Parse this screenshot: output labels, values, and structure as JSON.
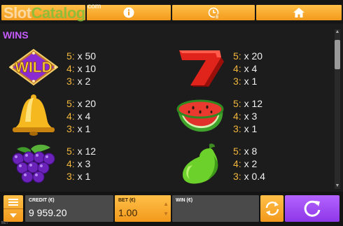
{
  "watermark": {
    "brand_part1": "Slot",
    "brand_part2": "Catalog",
    "domain": "com"
  },
  "topbar": {
    "tabs": [
      {
        "icon": "info-icon"
      },
      {
        "icon": "history-icon"
      },
      {
        "icon": "home-icon"
      }
    ],
    "accent": "#f5a623"
  },
  "paytable": {
    "title": "WINS",
    "symbols": [
      {
        "name": "wild",
        "icon": "wild-icon",
        "label": "WILD",
        "pays": [
          {
            "n": "5:",
            "v": "x 50"
          },
          {
            "n": "4:",
            "v": "x 10"
          },
          {
            "n": "3:",
            "v": "x 2"
          }
        ]
      },
      {
        "name": "seven",
        "icon": "seven-icon",
        "pays": [
          {
            "n": "5:",
            "v": "x 20"
          },
          {
            "n": "4:",
            "v": "x 4"
          },
          {
            "n": "3:",
            "v": "x 1"
          }
        ]
      },
      {
        "name": "bell",
        "icon": "bell-icon",
        "pays": [
          {
            "n": "5:",
            "v": "x 20"
          },
          {
            "n": "4:",
            "v": "x 4"
          },
          {
            "n": "3:",
            "v": "x 1"
          }
        ]
      },
      {
        "name": "watermelon",
        "icon": "watermelon-icon",
        "pays": [
          {
            "n": "5:",
            "v": "x 12"
          },
          {
            "n": "4:",
            "v": "x 3"
          },
          {
            "n": "3:",
            "v": "x 1"
          }
        ]
      },
      {
        "name": "grapes",
        "icon": "grapes-icon",
        "pays": [
          {
            "n": "5:",
            "v": "x 12"
          },
          {
            "n": "4:",
            "v": "x 3"
          },
          {
            "n": "3:",
            "v": "x 1"
          }
        ]
      },
      {
        "name": "pear",
        "icon": "pear-icon",
        "pays": [
          {
            "n": "5:",
            "v": "x 8"
          },
          {
            "n": "4:",
            "v": "x 2"
          },
          {
            "n": "3:",
            "v": "x 0.4"
          }
        ]
      }
    ]
  },
  "bottom": {
    "credit_label": "CREDIT (€)",
    "credit_value": "9 959.20",
    "bet_label": "BET (€)",
    "bet_value": "1.00",
    "win_label": "WIN (€)",
    "win_value": "",
    "spin_color": "#9b4dff"
  },
  "version": "BET"
}
